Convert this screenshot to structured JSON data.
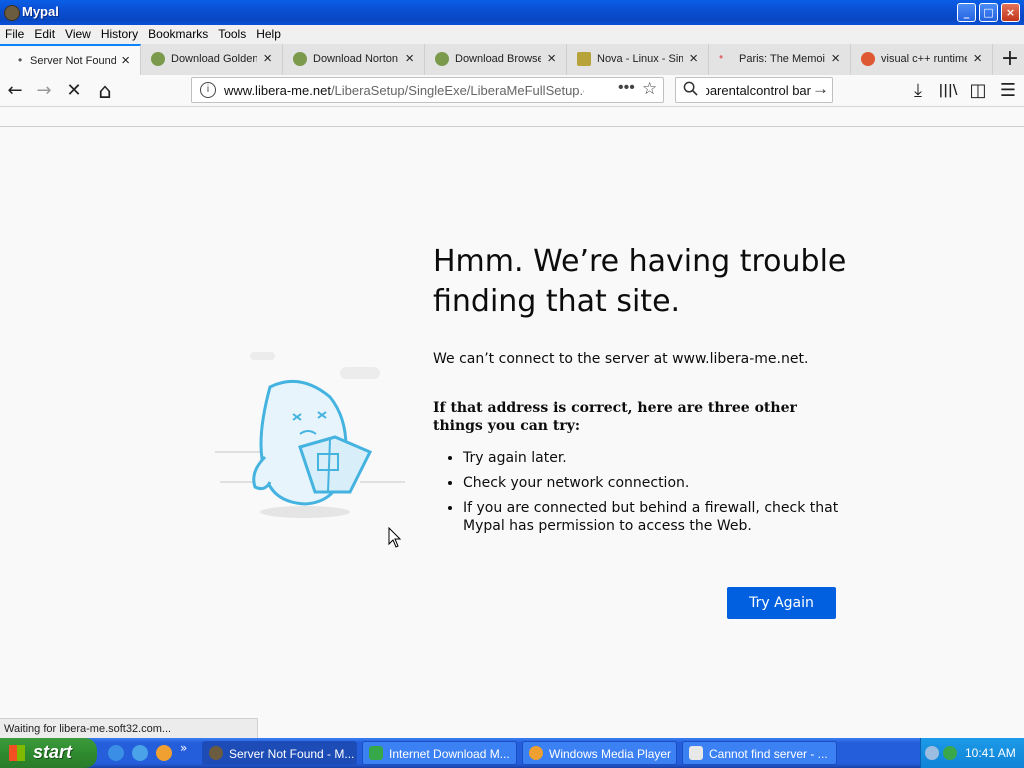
{
  "window": {
    "title": "Mypal",
    "min": "_",
    "max": "□",
    "close": "×"
  },
  "menu": [
    "File",
    "Edit",
    "View",
    "History",
    "Bookmarks",
    "Tools",
    "Help"
  ],
  "tabs": [
    {
      "label": "Server Not Found",
      "active": true
    },
    {
      "label": "Download Golden"
    },
    {
      "label": "Download Norton"
    },
    {
      "label": "Download Browser"
    },
    {
      "label": "Nova - Linux - Sim"
    },
    {
      "label": "Paris: The Memoir"
    },
    {
      "label": "visual c++ runtime"
    }
  ],
  "tab_close": "×",
  "newtab": "+",
  "nav": {
    "back": "←",
    "forward": "→",
    "stop": "✕",
    "home": "⌂",
    "url_domain": "www.libera-me.net",
    "url_path": "/LiberaSetup/SingleExe/LiberaMeFullSetup.exe",
    "page_actions": "•••",
    "bookmark_star": "☆",
    "search_value": "parentalcontrol bar",
    "search_go": "→",
    "downloads": "⤓",
    "library": "|||\\",
    "sidebar": "◫",
    "menu": "☰"
  },
  "content": {
    "title_line1": "Hmm. We’re having trouble",
    "title_line2": "finding that site.",
    "description": "We can’t connect to the server at www.libera-me.net.",
    "subtitle": "If that address is correct, here are three other things you can try:",
    "suggestions": [
      "Try again later.",
      "Check your network connection.",
      "If you are connected but behind a firewall, check that Mypal has permission to access the Web."
    ],
    "button": "Try Again"
  },
  "status": "Waiting for libera-me.soft32.com...",
  "taskbar": {
    "start": "start",
    "quicklaunch_more": "»",
    "tasks": [
      {
        "label": "Server Not Found - M...",
        "active": true
      },
      {
        "label": "Internet Download M..."
      },
      {
        "label": "Windows Media Player"
      },
      {
        "label": "Cannot find server - ..."
      }
    ],
    "clock": "10:41 AM"
  },
  "colors": {
    "accent": "#0060df",
    "tab_highlight": "#0a84ff",
    "taskbar": "#245edb",
    "start": "#2f8b2f"
  }
}
